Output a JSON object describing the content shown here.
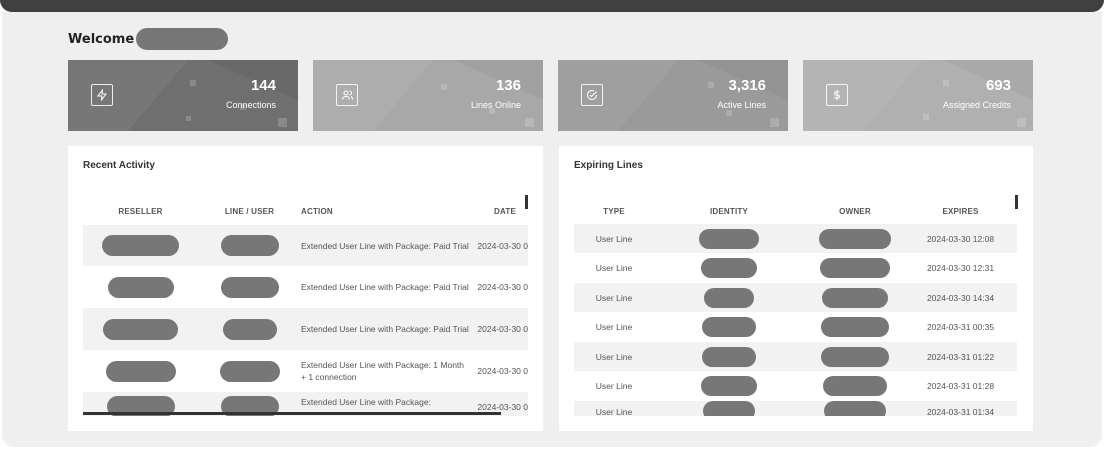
{
  "welcome": {
    "text": "Welcome"
  },
  "stats": [
    {
      "value": "144",
      "label": "Connections",
      "icon": "lightning-icon",
      "color": "#6f6f6f"
    },
    {
      "value": "136",
      "label": "Lines Online",
      "icon": "users-icon",
      "color": "#a8a8a8"
    },
    {
      "value": "3,316",
      "label": "Active Lines",
      "icon": "check-circle-icon",
      "color": "#9a9a9a"
    },
    {
      "value": "693",
      "label": "Assigned Credits",
      "icon": "dollar-icon",
      "color": "#b0b0b0"
    }
  ],
  "recent_activity": {
    "title": "Recent Activity",
    "columns": [
      "RESELLER",
      "LINE / USER",
      "ACTION",
      "DATE"
    ],
    "rows": [
      {
        "action": "Extended User Line with Package: Paid Trial",
        "date": "2024-03-30 0"
      },
      {
        "action": "Extended User Line with Package: Paid Trial",
        "date": "2024-03-30 0"
      },
      {
        "action": "Extended User Line with Package: Paid Trial",
        "date": "2024-03-30 0"
      },
      {
        "action": "Extended User Line with Package: 1 Month + 1 connection",
        "date": "2024-03-30 0"
      },
      {
        "action": "Extended User Line with Package:",
        "date": "2024-03-30 0"
      }
    ]
  },
  "expiring_lines": {
    "title": "Expiring Lines",
    "columns": [
      "TYPE",
      "IDENTITY",
      "OWNER",
      "EXPIRES"
    ],
    "rows": [
      {
        "type": "User Line",
        "expires": "2024-03-30 12:08"
      },
      {
        "type": "User Line",
        "expires": "2024-03-30 12:31"
      },
      {
        "type": "User Line",
        "expires": "2024-03-30 14:34"
      },
      {
        "type": "User Line",
        "expires": "2024-03-31 00:35"
      },
      {
        "type": "User Line",
        "expires": "2024-03-31 01:22"
      },
      {
        "type": "User Line",
        "expires": "2024-03-31 01:28"
      },
      {
        "type": "User Line",
        "expires": "2024-03-31 01:34"
      }
    ]
  }
}
